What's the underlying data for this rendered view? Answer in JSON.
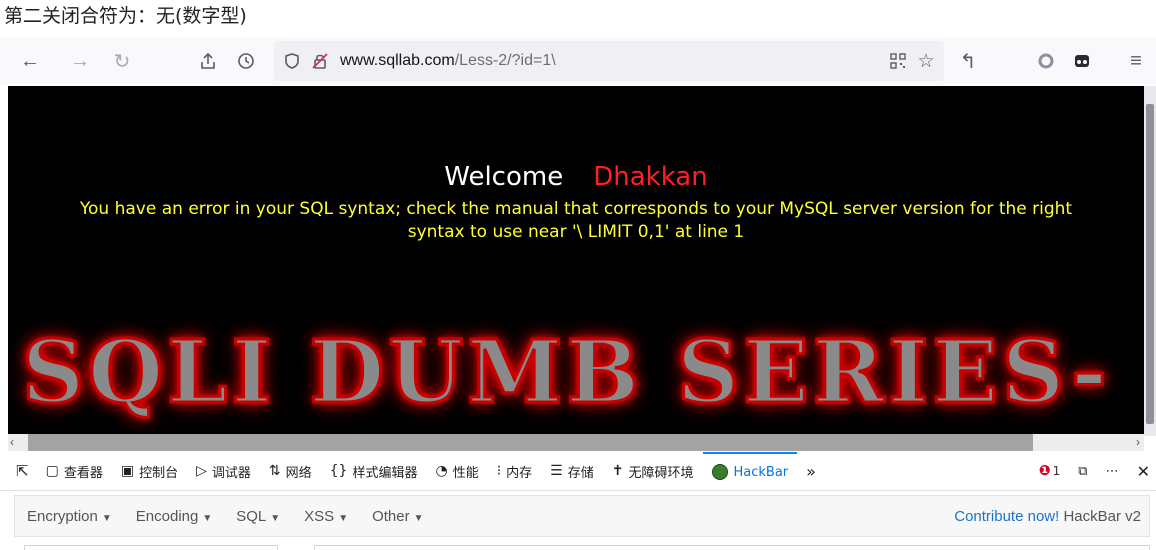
{
  "caption": "第二关闭合符为：无(数字型)",
  "browser": {
    "url_host": "www.sqllab.com",
    "url_path": "/Less-2/?id=1\\"
  },
  "page": {
    "welcome": "Welcome",
    "name": "Dhakkan",
    "error_line1": "You have an error in your SQL syntax; check the manual that corresponds to your MySQL server version for the right",
    "error_line2": "syntax to use near '\\ LIMIT 0,1' at line 1",
    "banner": "SQLI DUMB SERIES-"
  },
  "devtools": {
    "tabs": [
      {
        "label": "查看器",
        "icon": "inspector-icon"
      },
      {
        "label": "控制台",
        "icon": "console-icon"
      },
      {
        "label": "调试器",
        "icon": "debugger-icon"
      },
      {
        "label": "网络",
        "icon": "network-icon"
      },
      {
        "label": "样式编辑器",
        "icon": "style-editor-icon"
      },
      {
        "label": "性能",
        "icon": "performance-icon"
      },
      {
        "label": "内存",
        "icon": "memory-icon"
      },
      {
        "label": "存储",
        "icon": "storage-icon"
      },
      {
        "label": "无障碍环境",
        "icon": "accessibility-icon"
      },
      {
        "label": "HackBar",
        "icon": "hackbar-icon"
      }
    ],
    "error_count": "1"
  },
  "hackbar": {
    "menus": [
      "Encryption",
      "Encoding",
      "SQL",
      "XSS",
      "Other"
    ],
    "contribute": "Contribute now!",
    "version": "HackBar v2"
  },
  "colors": {
    "accent": "#0a84ff",
    "error_text": "#ffff33",
    "name_text": "#ff2020"
  }
}
